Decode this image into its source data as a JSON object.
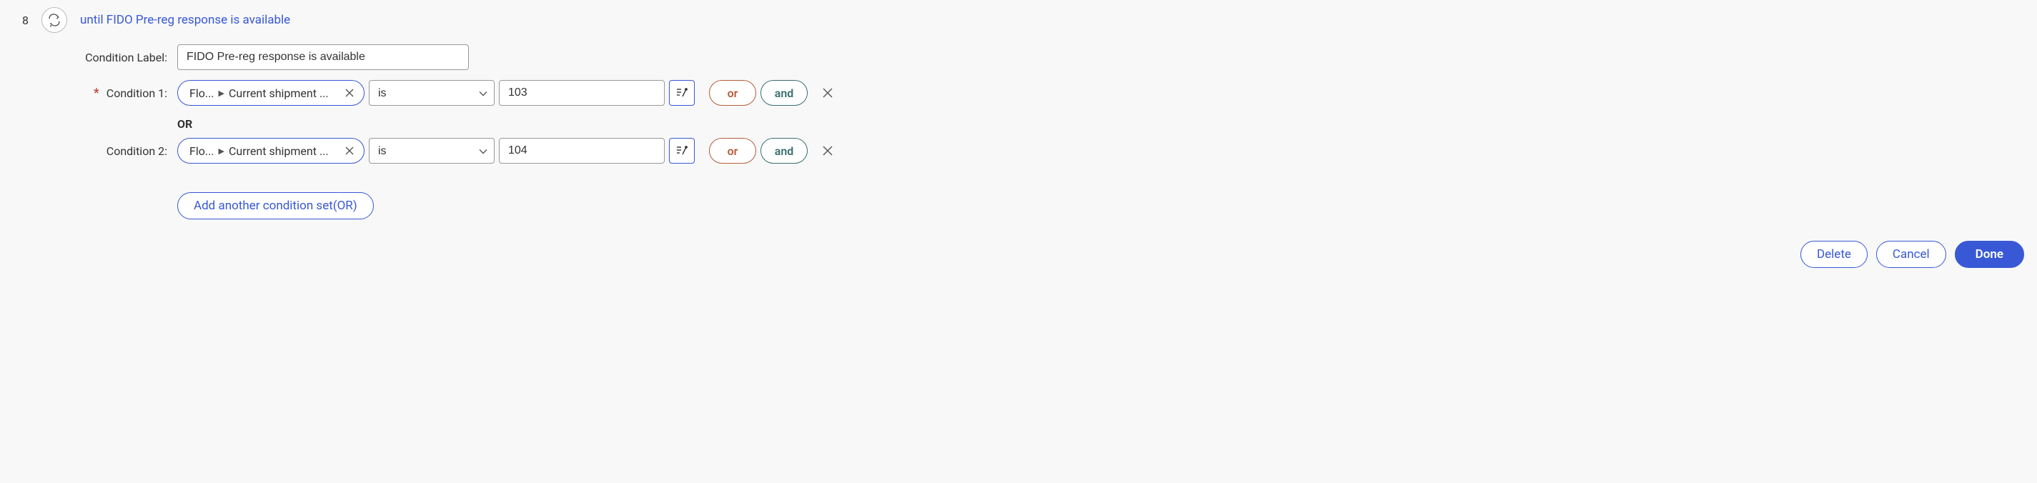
{
  "step_number": "8",
  "header_title": "until FIDO Pre-reg response is available",
  "condition_label_label": "Condition Label:",
  "condition_label_value": "FIDO Pre-reg response is available",
  "or_separator": "OR",
  "conditions": [
    {
      "label": "Condition 1:",
      "required": true,
      "path_seg1": "Flo...",
      "path_seg2": "Current shipment ...",
      "operator": "is",
      "value": "103",
      "or_label": "or",
      "and_label": "and"
    },
    {
      "label": "Condition 2:",
      "required": false,
      "path_seg1": "Flo...",
      "path_seg2": "Current shipment ...",
      "operator": "is",
      "value": "104",
      "or_label": "or",
      "and_label": "and"
    }
  ],
  "add_set_label": "Add another condition set(OR)",
  "footer": {
    "delete": "Delete",
    "cancel": "Cancel",
    "done": "Done"
  }
}
